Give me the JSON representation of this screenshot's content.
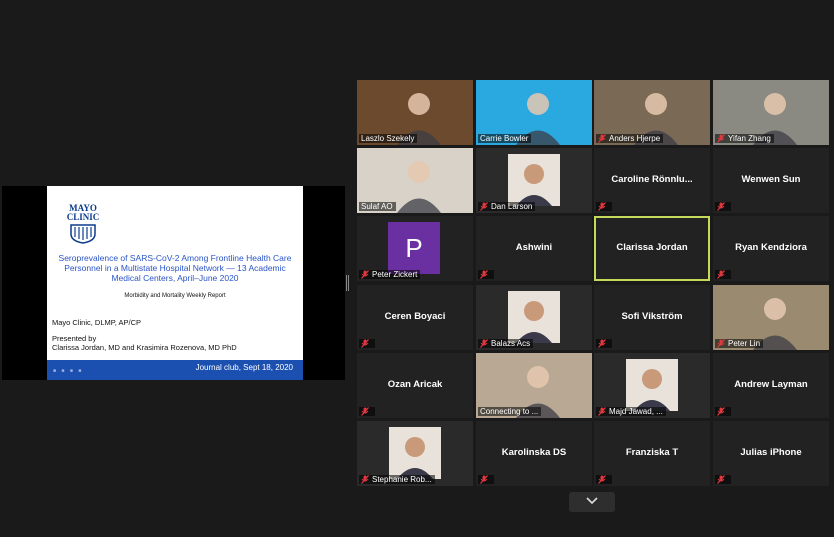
{
  "share": {
    "logo_line1": "MAYO",
    "logo_line2": "CLINIC",
    "title": "Seroprevalence of SARS-CoV-2 Among Frontline Health Care Personnel in a Multistate Hospital Network — 13 Academic Medical Centers, April–June 2020",
    "subtitle": "Morbidity and Mortality Weekly Report",
    "affiliation": "Mayo Clinic, DLMP,  AP/CP",
    "presented_line1": "Presented by",
    "presented_line2": "Clarissa Jordan, MD and Krasimira Rozenova, MD PhD",
    "footer": "Journal club, Sept 18, 2020",
    "footer_dots": "■ ■ ■ ■"
  },
  "participants": [
    {
      "name": "Laszlo Szekely",
      "video": true,
      "muted": false
    },
    {
      "name": "Carrie Bowler",
      "video": true,
      "muted": false
    },
    {
      "name": "Anders Hjerpe",
      "video": true,
      "muted": true
    },
    {
      "name": "Yifan Zhang",
      "video": true,
      "muted": true
    },
    {
      "name": "Sulaf AO",
      "video": true,
      "muted": false
    },
    {
      "name": "Dan Larson",
      "video": true,
      "muted": true
    },
    {
      "name": "Caroline  Rönnlu...",
      "video": false,
      "muted": true
    },
    {
      "name": "Wenwen Sun",
      "video": false,
      "muted": true
    },
    {
      "name": "Peter Zickert",
      "video": false,
      "muted": true,
      "avatar": "P"
    },
    {
      "name": "Ashwini",
      "video": false,
      "muted": true
    },
    {
      "name": "Clarissa Jordan",
      "video": false,
      "muted": false,
      "active": true
    },
    {
      "name": "Ryan Kendziora",
      "video": false,
      "muted": true
    },
    {
      "name": "Ceren Boyaci",
      "video": false,
      "muted": true
    },
    {
      "name": "Balazs Acs",
      "video": true,
      "muted": true
    },
    {
      "name": "Sofi Vikström",
      "video": false,
      "muted": true
    },
    {
      "name": "Peter Lin",
      "video": true,
      "muted": true
    },
    {
      "name": "Ozan Aricak",
      "video": false,
      "muted": true
    },
    {
      "name": "Connecting to ...",
      "video": true,
      "muted": false
    },
    {
      "name": "Majd Jawad, ...",
      "video": true,
      "muted": true
    },
    {
      "name": "Andrew Layman",
      "video": false,
      "muted": true
    },
    {
      "name": "Stephanie Rob...",
      "video": true,
      "muted": true
    },
    {
      "name": "Karolinska DS",
      "video": false,
      "muted": true
    },
    {
      "name": "Franziska T",
      "video": false,
      "muted": true
    },
    {
      "name": "Julias iPhone",
      "video": false,
      "muted": true
    }
  ],
  "colors": {
    "active_border": "#c6d95a",
    "mute_icon": "#e0383e",
    "avatar_bg": "#6a2fa0"
  },
  "icons": {
    "mute": "microphone-muted-icon",
    "scroll": "chevron-down-icon"
  }
}
